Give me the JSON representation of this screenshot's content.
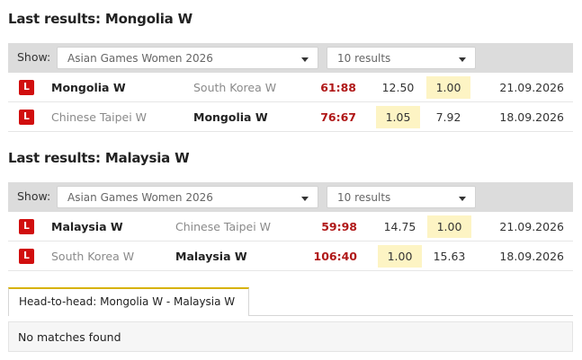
{
  "sections": [
    {
      "title": "Last results: Mongolia W",
      "filter": {
        "show_label": "Show:",
        "competition": "Asian Games Women 2026",
        "results": "10 results"
      },
      "rows": [
        {
          "badge": "L",
          "home": "Mongolia W",
          "away": "South Korea W",
          "winner": "home",
          "score": "61:88",
          "odd1": "12.50",
          "odd2": "1.00",
          "highlight": 2,
          "date": "21.09.2026"
        },
        {
          "badge": "L",
          "home": "Chinese Taipei W",
          "away": "Mongolia W",
          "winner": "away",
          "score": "76:67",
          "odd1": "1.05",
          "odd2": "7.92",
          "highlight": 1,
          "date": "18.09.2026"
        }
      ]
    },
    {
      "title": "Last results: Malaysia W",
      "filter": {
        "show_label": "Show:",
        "competition": "Asian Games Women 2026",
        "results": "10 results"
      },
      "rows": [
        {
          "badge": "L",
          "home": "Malaysia W",
          "away": "Chinese Taipei W",
          "winner": "home",
          "score": "59:98",
          "odd1": "14.75",
          "odd2": "1.00",
          "highlight": 2,
          "date": "21.09.2026"
        },
        {
          "badge": "L",
          "home": "South Korea W",
          "away": "Malaysia W",
          "winner": "away",
          "score": "106:40",
          "odd1": "1.00",
          "odd2": "15.63",
          "highlight": 1,
          "date": "18.09.2026"
        }
      ]
    }
  ],
  "h2h": {
    "tab_label": "Head-to-head: Mongolia W - Malaysia W",
    "empty_text": "No matches found"
  },
  "colors": {
    "loss_badge": "#d10e0e",
    "score": "#b01818",
    "odd_highlight": "#fdf4c4",
    "tab_accent": "#d7b200"
  }
}
